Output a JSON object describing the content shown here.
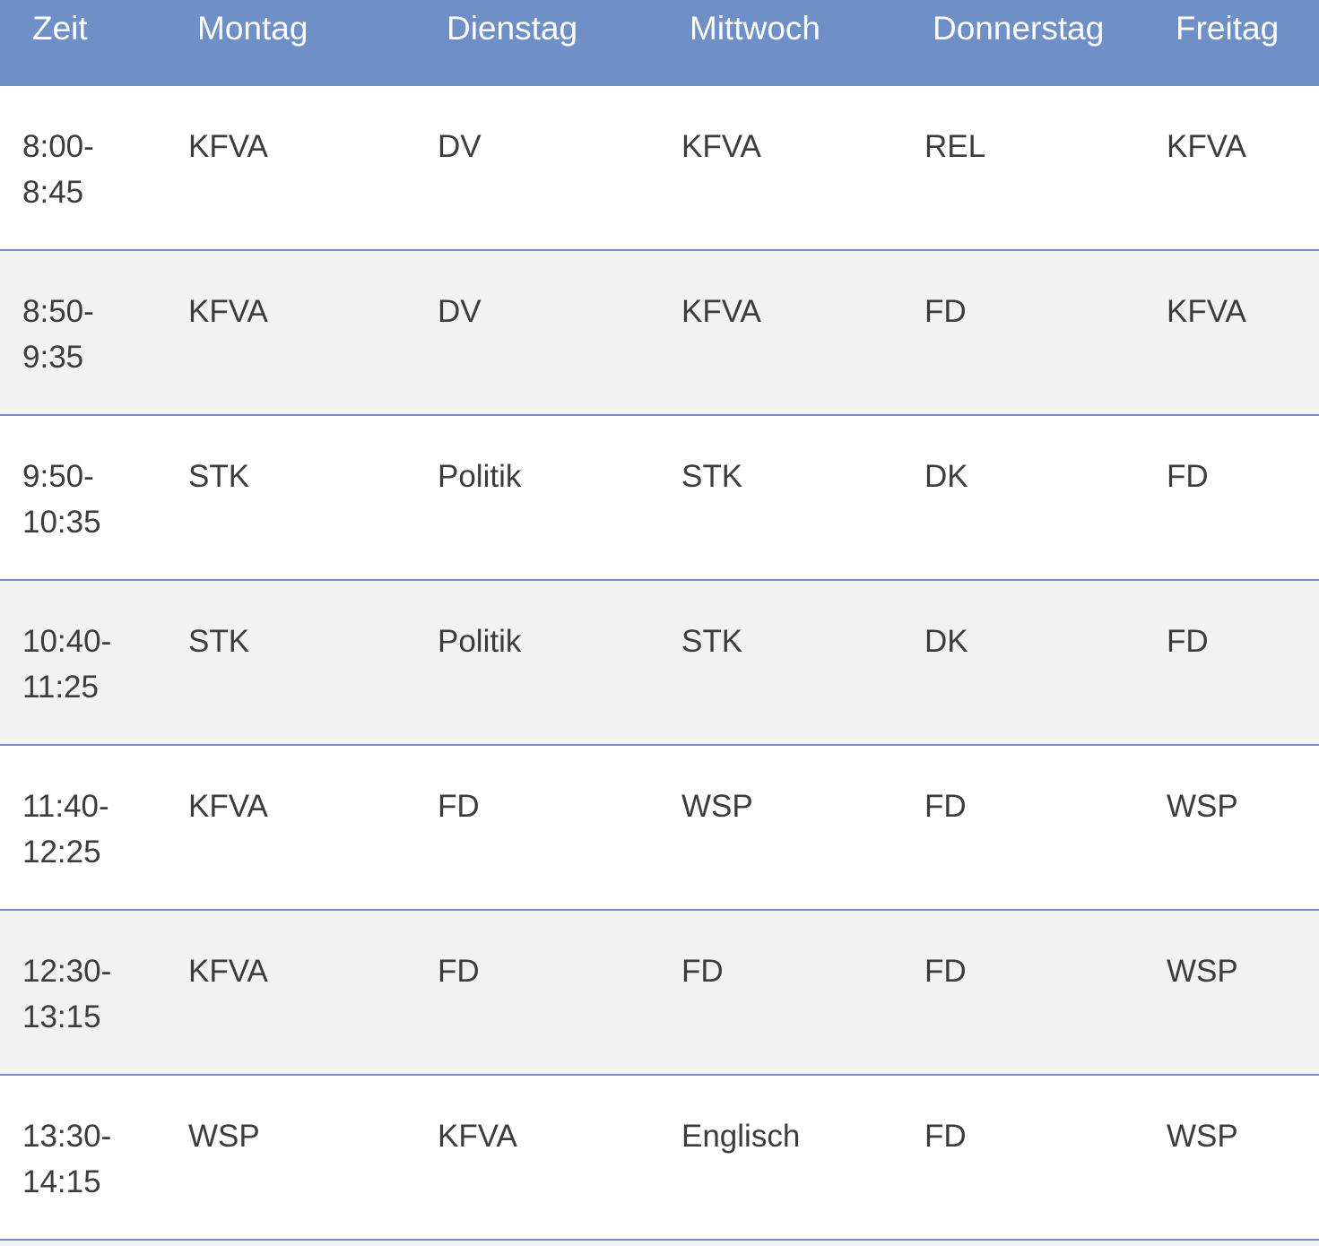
{
  "header": {
    "columns": [
      "Zeit",
      "Montag",
      "Dienstag",
      "Mittwoch",
      "Donnerstag",
      "Freitag"
    ]
  },
  "rows": [
    {
      "start": "8:00-",
      "end": "8:45",
      "subjects": [
        "KFVA",
        "DV",
        "KFVA",
        "REL",
        "KFVA"
      ]
    },
    {
      "start": "8:50-",
      "end": "9:35",
      "subjects": [
        "KFVA",
        "DV",
        "KFVA",
        "FD",
        "KFVA"
      ]
    },
    {
      "start": "9:50-",
      "end": "10:35",
      "subjects": [
        "STK",
        "Politik",
        "STK",
        "DK",
        "FD"
      ]
    },
    {
      "start": "10:40-",
      "end": "11:25",
      "subjects": [
        "STK",
        "Politik",
        "STK",
        "DK",
        "FD"
      ]
    },
    {
      "start": "11:40-",
      "end": "12:25",
      "subjects": [
        "KFVA",
        "FD",
        "WSP",
        "FD",
        "WSP"
      ]
    },
    {
      "start": "12:30-",
      "end": "13:15",
      "subjects": [
        "KFVA",
        "FD",
        "FD",
        "FD",
        "WSP"
      ]
    },
    {
      "start": "13:30-",
      "end": "14:15",
      "subjects": [
        "WSP",
        "KFVA",
        "Englisch",
        "FD",
        "WSP"
      ]
    }
  ],
  "colors": {
    "header_bg": "#6e90c6",
    "row_alt_bg": "#f2f2f2",
    "divider": "#6e90c6",
    "text": "#3c3c3c"
  }
}
